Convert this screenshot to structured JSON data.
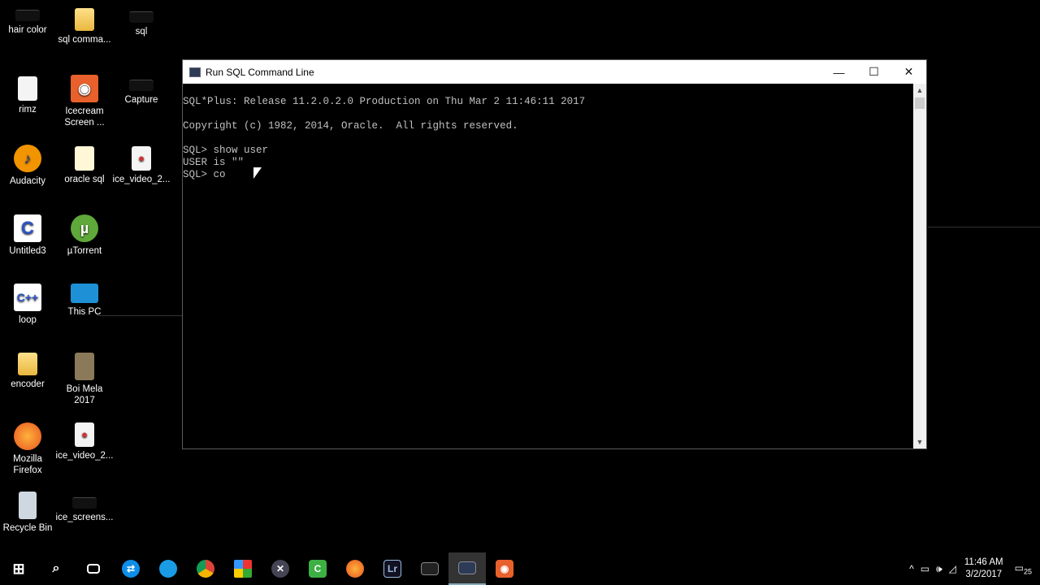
{
  "desktop": {
    "icons": [
      {
        "label": "hair color"
      },
      {
        "label": "sql comma..."
      },
      {
        "label": "sql"
      },
      {
        "label": "rimz"
      },
      {
        "label": "Icecream Screen ..."
      },
      {
        "label": "Capture"
      },
      {
        "label": "Audacity"
      },
      {
        "label": "oracle sql"
      },
      {
        "label": "ice_video_2..."
      },
      {
        "label": "Untitled3"
      },
      {
        "label": "µTorrent"
      },
      {
        "label": "loop"
      },
      {
        "label": "This PC"
      },
      {
        "label": "encoder"
      },
      {
        "label": "Boi Mela 2017"
      },
      {
        "label": "Mozilla Firefox"
      },
      {
        "label": "ice_video_2..."
      },
      {
        "label": "Recycle Bin"
      },
      {
        "label": "ice_screens..."
      }
    ]
  },
  "window": {
    "title": "Run SQL Command Line",
    "minimize_glyph": "—",
    "maximize_glyph": "☐",
    "close_glyph": "✕",
    "console_lines": [
      "SQL*Plus: Release 11.2.0.2.0 Production on Thu Mar 2 11:46:11 2017",
      "",
      "Copyright (c) 1982, 2014, Oracle.  All rights reserved.",
      "",
      "SQL> show user",
      "USER is \"\"",
      "SQL> co"
    ]
  },
  "taskbar": {
    "icons": [
      "windows-start-icon",
      "search-icon",
      "task-view-icon",
      "teamviewer-icon",
      "edge-icon",
      "chrome-icon",
      "app-grid-icon",
      "mixer-icon",
      "camtasia-icon",
      "firefox-icon",
      "lightroom-icon",
      "cmd-icon",
      "sql-cmd-icon",
      "icecream-icon"
    ],
    "lightroom_label": "Lr",
    "time": "11:46 AM",
    "date": "3/2/2017",
    "notification_count": "25"
  }
}
